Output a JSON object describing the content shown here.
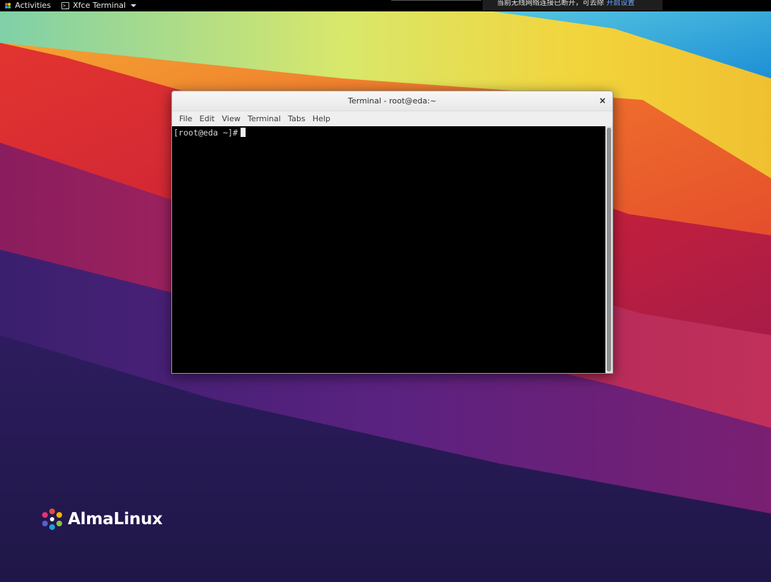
{
  "top_panel": {
    "activities_label": "Activities",
    "app_menu_label": "Xfce Terminal",
    "notification_text": "当前无线网络连接已断开，可去除",
    "notification_link": "开启设置"
  },
  "terminal": {
    "title": "Terminal - root@eda:~",
    "close_glyph": "×",
    "menu": [
      "File",
      "Edit",
      "View",
      "Terminal",
      "Tabs",
      "Help"
    ],
    "prompt": "[root@eda ~]#"
  },
  "desktop": {
    "logo_text": "AlmaLinux"
  },
  "colors": {
    "panel": "#000000",
    "terminal_bg": "#000000",
    "wallpaper_dark": "#1f1747"
  },
  "icons": {
    "activities": "activities-icon",
    "app": "terminal-app-icon",
    "close": "close-icon",
    "logo": "almalinux-logo-icon"
  }
}
